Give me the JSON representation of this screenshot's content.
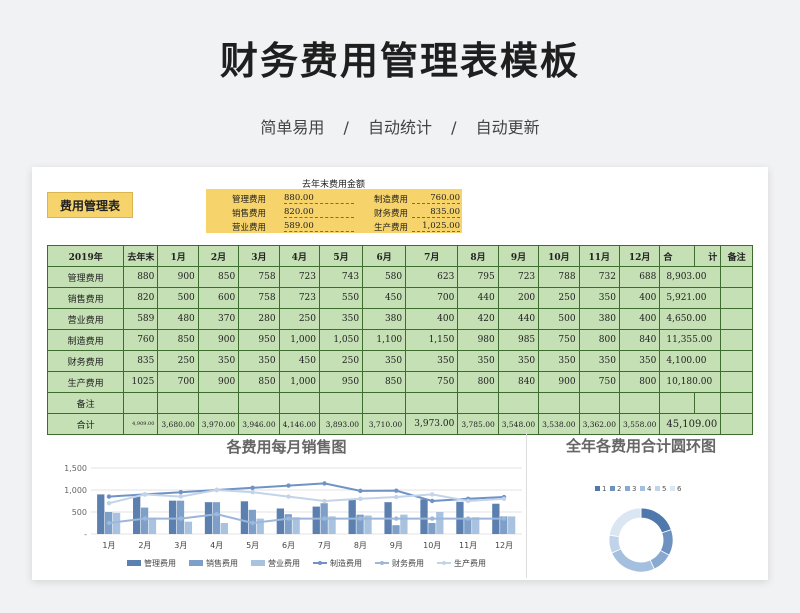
{
  "header": {
    "title": "财务费用管理表模板",
    "sub1": "简单易用",
    "sep1": "/",
    "sub2": "自动统计",
    "sep2": "/",
    "sub3": "自动更新"
  },
  "sheet": {
    "tag": "费用管理表",
    "summary": {
      "title": "去年末费用金额",
      "items": [
        {
          "label": "管理费用",
          "value": "880.00"
        },
        {
          "label": "制造费用",
          "value": "760.00"
        },
        {
          "label": "销售费用",
          "value": "820.00"
        },
        {
          "label": "财务费用",
          "value": "835.00"
        },
        {
          "label": "营业费用",
          "value": "589.00"
        },
        {
          "label": "生产费用",
          "value": "1,025.00"
        }
      ]
    },
    "table": {
      "headers": [
        "2019年",
        "去年末",
        "1月",
        "2月",
        "3月",
        "4月",
        "5月",
        "6月",
        "7月",
        "8月",
        "9月",
        "10月",
        "11月",
        "12月",
        "合",
        "计",
        "备注"
      ],
      "rows": [
        [
          "管理费用",
          "880",
          "900",
          "850",
          "758",
          "723",
          "743",
          "580",
          "623",
          "795",
          "723",
          "788",
          "732",
          "688",
          "8,903.00"
        ],
        [
          "销售费用",
          "820",
          "500",
          "600",
          "758",
          "723",
          "550",
          "450",
          "700",
          "440",
          "200",
          "250",
          "350",
          "400",
          "5,921.00"
        ],
        [
          "营业费用",
          "589",
          "480",
          "370",
          "280",
          "250",
          "350",
          "380",
          "400",
          "420",
          "440",
          "500",
          "380",
          "400",
          "4,650.00"
        ],
        [
          "制造费用",
          "760",
          "850",
          "900",
          "950",
          "1,000",
          "1,050",
          "1,100",
          "1,150",
          "980",
          "985",
          "750",
          "800",
          "840",
          "11,355.00"
        ],
        [
          "财务费用",
          "835",
          "250",
          "350",
          "350",
          "450",
          "250",
          "350",
          "350",
          "350",
          "350",
          "350",
          "350",
          "350",
          "4,100.00"
        ],
        [
          "生产费用",
          "1025",
          "700",
          "900",
          "850",
          "1,000",
          "950",
          "850",
          "750",
          "800",
          "840",
          "900",
          "750",
          "800",
          "10,180.00"
        ]
      ],
      "remark_label": "备注",
      "total_label": "合计",
      "totals": [
        "4,909.00",
        "3,680.00",
        "3,970.00",
        "3,946.00",
        "4,146.00",
        "3,893.00",
        "3,710.00",
        "3,973.00",
        "3,785.00",
        "3,548.00",
        "3,538.00",
        "3,362.00",
        "3,558.00",
        "45,109.00"
      ]
    }
  },
  "chart_data": [
    {
      "type": "bar",
      "title": "各费用每月销售图",
      "categories": [
        "1月",
        "2月",
        "3月",
        "4月",
        "5月",
        "6月",
        "7月",
        "8月",
        "9月",
        "10月",
        "11月",
        "12月"
      ],
      "ylim": [
        0,
        1500
      ],
      "yticks": [
        "1,500",
        "1,000",
        "500",
        "-"
      ],
      "series": [
        {
          "name": "管理费用",
          "kind": "bar",
          "color": "#5b7fae",
          "values": [
            900,
            850,
            758,
            723,
            743,
            580,
            623,
            795,
            723,
            788,
            732,
            688
          ]
        },
        {
          "name": "销售费用",
          "kind": "bar",
          "color": "#7ea0c8",
          "values": [
            500,
            600,
            758,
            723,
            550,
            450,
            700,
            440,
            200,
            250,
            350,
            400
          ]
        },
        {
          "name": "营业费用",
          "kind": "bar",
          "color": "#a9c2df",
          "values": [
            480,
            370,
            280,
            250,
            350,
            380,
            400,
            420,
            440,
            500,
            380,
            400
          ]
        },
        {
          "name": "制造费用",
          "kind": "line",
          "color": "#6f93c4",
          "values": [
            850,
            900,
            950,
            1000,
            1050,
            1100,
            1150,
            980,
            985,
            750,
            800,
            840
          ]
        },
        {
          "name": "财务费用",
          "kind": "line",
          "color": "#9bb7da",
          "values": [
            250,
            350,
            350,
            450,
            250,
            350,
            350,
            350,
            350,
            350,
            350,
            350
          ]
        },
        {
          "name": "生产费用",
          "kind": "line",
          "color": "#c3d4ea",
          "values": [
            700,
            900,
            850,
            1000,
            950,
            850,
            750,
            800,
            840,
            900,
            750,
            800
          ]
        }
      ],
      "legend": "bottom"
    },
    {
      "type": "pie",
      "title": "全年各费用合计圆环图",
      "categories": [
        "1",
        "2",
        "3",
        "4",
        "5",
        "6"
      ],
      "values": [
        8903,
        5921,
        4650,
        11355,
        4100,
        10180
      ],
      "colors": [
        "#4f78ad",
        "#6d91c0",
        "#8aa9d1",
        "#a5bfdf",
        "#c1d3ea",
        "#dbe6f3"
      ],
      "legend": "top"
    }
  ]
}
